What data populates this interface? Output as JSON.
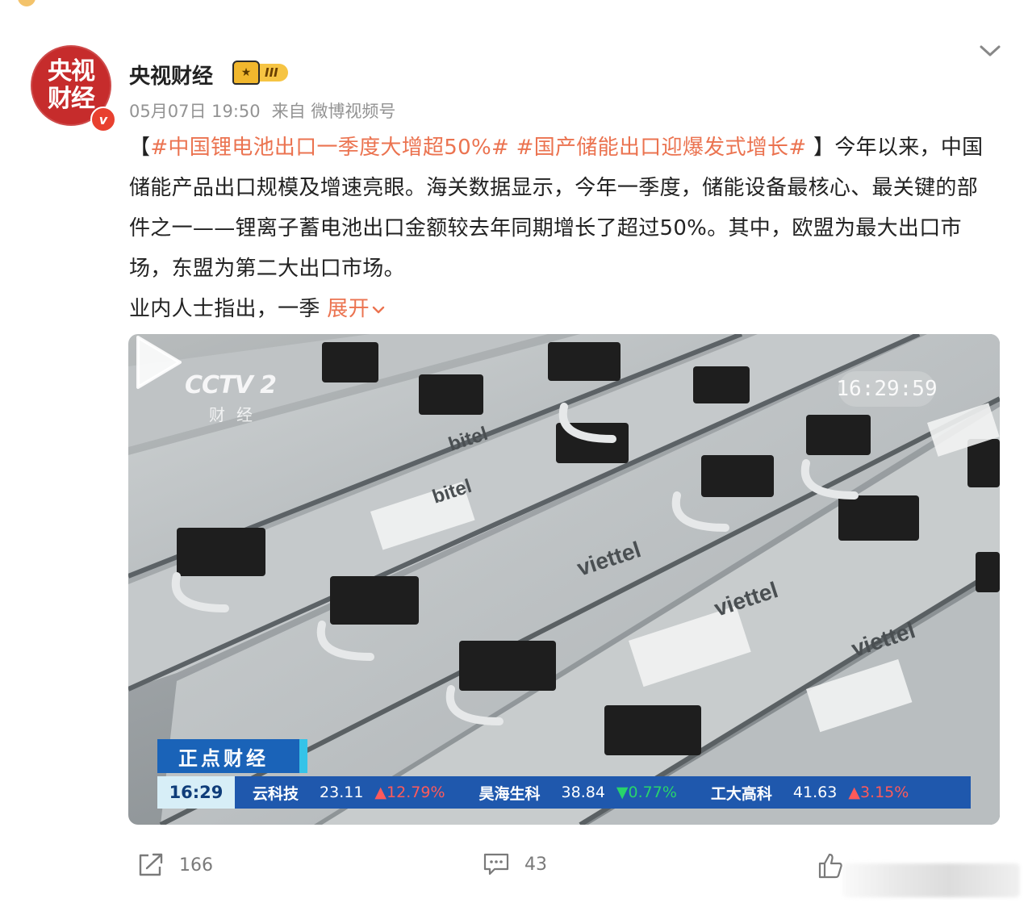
{
  "post": {
    "author": {
      "name": "央视财经",
      "avatar_line1": "央视",
      "avatar_line2": "财经",
      "verified_mark": "v",
      "level_badge": "III"
    },
    "timestamp": "05月07日 19:50",
    "source": "来自 微博视频号",
    "text": {
      "bracket_open": "【",
      "tag1": "#中国锂电池出口一季度大增超50%#",
      "tag2": "#国产储能出口迎爆发式增长#",
      "bracket_close": "】",
      "para1": "今年以来，中国储能产品出口规模及增速亮眼。海关数据显示，今年一季度，储能设备最核心、最关键的部件之一——锂离子蓄电池出口金额较去年同期增长了超过50%。其中，欧盟为最大出口市场，东盟为第二大出口市场。",
      "para2": "业内人士指出，一季",
      "expand_label": "展开"
    },
    "video": {
      "channel_logo": "CCTV 2",
      "channel_sub": "财经",
      "clock": "16:29:59",
      "program_name": "正点财经",
      "ticker": {
        "time": "16:29",
        "stocks": [
          {
            "name": "云科技",
            "price": "23.11",
            "change": "12.79%",
            "direction": "up"
          },
          {
            "name": "昊海生科",
            "price": "38.84",
            "change": "0.77%",
            "direction": "down"
          },
          {
            "name": "工大高科",
            "price": "41.63",
            "change": "3.15%",
            "direction": "up"
          }
        ]
      },
      "labels": [
        "bitel",
        "bitel",
        "viettel",
        "viettel",
        "viettel"
      ]
    },
    "actions": {
      "repost_count": "166",
      "comment_count": "43"
    },
    "colors": {
      "accent": "#eb7350",
      "meta_gray": "#939393",
      "ticker_blue": "#1f58ad",
      "up_red": "#ff5a5a",
      "down_green": "#28d36b"
    },
    "icons": [
      "avatar-logo",
      "verified-icon",
      "crown-icon",
      "chevron-down-icon",
      "play-icon",
      "repost-icon",
      "comment-icon",
      "like-icon"
    ]
  }
}
